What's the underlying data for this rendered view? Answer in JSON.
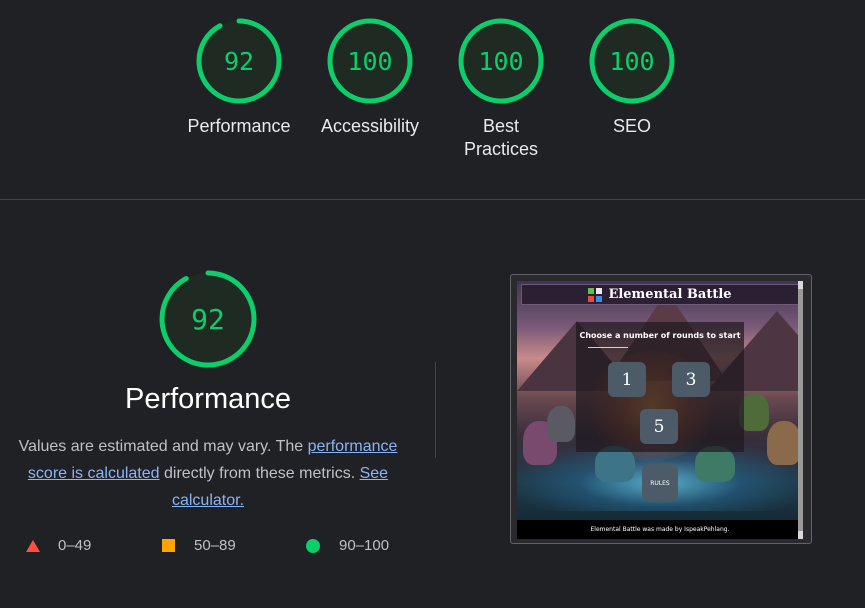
{
  "summary_gauges": [
    {
      "score": "92",
      "label": "Performance",
      "fraction": 0.92
    },
    {
      "score": "100",
      "label": "Accessibility",
      "fraction": 1.0
    },
    {
      "score": "100",
      "label": "Best Practices",
      "fraction": 1.0
    },
    {
      "score": "100",
      "label": "SEO",
      "fraction": 1.0
    }
  ],
  "main": {
    "score": "92",
    "fraction": 0.92,
    "title": "Performance",
    "desc_prefix": "Values are estimated and may vary. The ",
    "link_score": "performance score is calculated",
    "desc_middle": " directly from these metrics. ",
    "link_calc": "See calculator."
  },
  "legend": [
    {
      "range": "0–49",
      "icon": "triangle-icon",
      "color": "#ff4e42"
    },
    {
      "range": "50–89",
      "icon": "square-icon",
      "color": "#ffa400"
    },
    {
      "range": "90–100",
      "icon": "circle-icon",
      "color": "#0cce6b"
    }
  ],
  "screenshot": {
    "title": "Elemental Battle",
    "prompt": "Choose a number of rounds to start",
    "rounds": [
      "1",
      "3",
      "5"
    ],
    "rules": "RULES",
    "footer": "Elemental Battle was made by IspeakPehlang."
  },
  "colors": {
    "pass": "#0cce6b",
    "average": "#ffa400",
    "fail": "#ff4e42",
    "link": "#8ab4f8"
  }
}
